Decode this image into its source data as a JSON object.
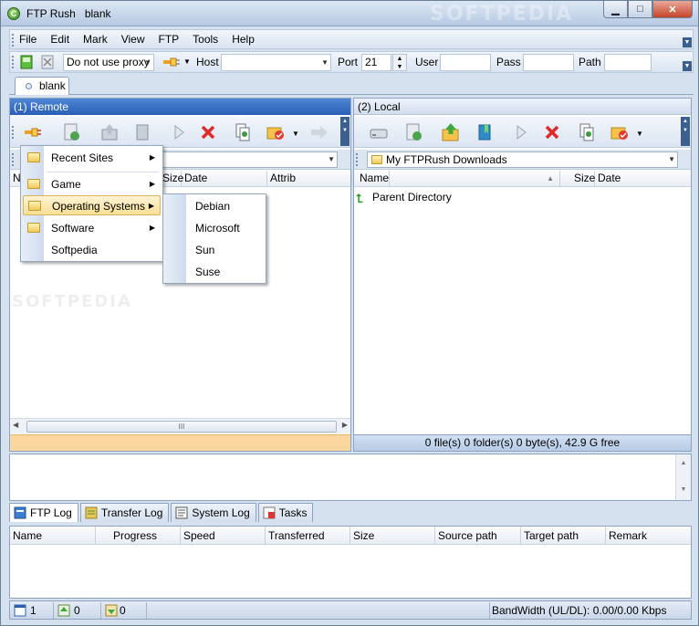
{
  "window": {
    "app_name": "FTP Rush",
    "session": "blank",
    "buttons": {
      "minimize": "▁",
      "maximize": "□",
      "close": "✕"
    },
    "watermark": "SOFTPEDIA"
  },
  "menubar": [
    "File",
    "Edit",
    "Mark",
    "View",
    "FTP",
    "Tools",
    "Help"
  ],
  "toolbar": {
    "proxy": "Do not use proxy",
    "host_label": "Host",
    "host_value": "",
    "port_label": "Port",
    "port_value": "21",
    "user_label": "User",
    "user_value": "",
    "pass_label": "Pass",
    "pass_value": "",
    "path_label": "Path",
    "path_value": ""
  },
  "tabs": [
    {
      "label": "blank"
    }
  ],
  "remote": {
    "title": "(1) Remote",
    "path": "",
    "columns": [
      "N",
      "Size",
      "Date",
      "Attrib"
    ],
    "scroll_grip": "III"
  },
  "local": {
    "title": "(2) Local",
    "path": "My FTPRush Downloads",
    "columns": [
      "Name",
      "Size",
      "Date"
    ],
    "rows": [
      {
        "name": "Parent Directory"
      }
    ],
    "status": "0 file(s) 0 folder(s) 0 byte(s), 42.9 G free"
  },
  "menu": {
    "items": [
      {
        "label": "Recent Sites",
        "submenu": true
      },
      {
        "label": "Game",
        "submenu": true
      },
      {
        "label": "Operating Systems",
        "submenu": true,
        "highlighted": true
      },
      {
        "label": "Software",
        "submenu": true
      },
      {
        "label": "Softpedia",
        "submenu": false
      }
    ],
    "submenu_items": [
      "Debian",
      "Microsoft",
      "Sun",
      "Suse"
    ]
  },
  "bottom_tabs": [
    {
      "label": "FTP Log",
      "active": true,
      "icon": "log-icon"
    },
    {
      "label": "Transfer Log",
      "active": false,
      "icon": "transfer-log-icon"
    },
    {
      "label": "System Log",
      "active": false,
      "icon": "system-log-icon"
    },
    {
      "label": "Tasks",
      "active": false,
      "icon": "tasks-icon"
    }
  ],
  "queue_columns": [
    "Name",
    "Progress",
    "Speed",
    "Transferred",
    "Size",
    "Source path",
    "Target path",
    "Remark"
  ],
  "statusbar": {
    "c1": "1",
    "c2": "0",
    "c3": "0",
    "bandwidth": "BandWidth (UL/DL): 0.00/0.00 Kbps"
  }
}
